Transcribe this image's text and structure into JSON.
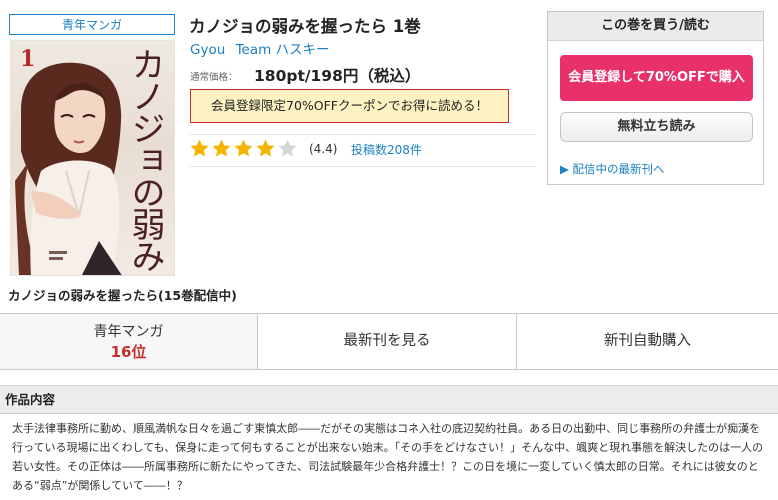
{
  "genre_badge": "青年マンガ",
  "cover": {
    "volume": "1",
    "title_art": "カノジョの弱みを握ったら",
    "alt": "カノジョの弱みを握ったら 1巻 表紙"
  },
  "series_caption": "カノジョの弱みを握ったら(15巻配信中)",
  "book": {
    "title": "カノジョの弱みを握ったら 1巻",
    "authors": [
      "Gyou",
      "Team ハスキー"
    ],
    "price_label": "通常価格：",
    "price": "180pt/198円（税込）",
    "coupon": "会員登録限定70%OFFクーポンでお得に読める！",
    "rating_stars": 4,
    "rating_max": 5,
    "rating_value": "(4.4)",
    "review_count": "投稿数208件"
  },
  "purchase_panel": {
    "heading": "この巻を買う/読む",
    "register_button": "会員登録して70%OFFで購入",
    "trial_button": "無料立ち読み",
    "latest_link": "▶ 配信中の最新刊へ"
  },
  "stats": {
    "rank_genre": "青年マンガ",
    "rank_value": "16位",
    "latest_label": "最新刊を見る",
    "auto_buy_label": "新刊自動購入"
  },
  "description": {
    "heading": "作品内容",
    "text": "太手法律事務所に勤め、順風満帆な日々を過ごす東慎太郎――だがその実態はコネ入社の底辺契約社員。ある日の出勤中、同じ事務所の弁護士が痴漢を行っている現場に出くわしても、保身に走って何もすることが出来ない始末。「その手をどけなさい！」そんな中、颯爽と現れ事態を解決したのは一人の若い女性。その正体は――所属事務所に新たにやってきた、司法試験最年少合格弁護士！？この日を境に一変していく慎太郎の日常。それには彼女のとある“弱点”が関係していて――！？"
  },
  "colors": {
    "link": "#1c80c2",
    "cta": "#e8316a",
    "rank": "#c4302b",
    "coupon_bg": "#fdf2c2",
    "star_on": "#f5b400",
    "star_off": "#d6d6d6"
  },
  "icons": {
    "star": "star-icon",
    "arrow": "triangle-right-icon"
  }
}
